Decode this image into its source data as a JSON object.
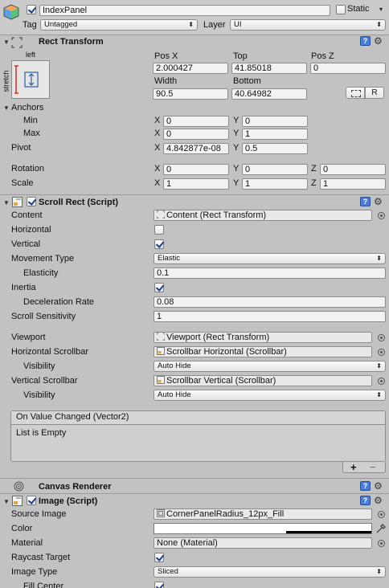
{
  "gameobject": {
    "name": "IndexPanel",
    "static_label": "Static",
    "tag_label": "Tag",
    "tag_value": "Untagged",
    "layer_label": "Layer",
    "layer_value": "UI"
  },
  "rect_transform": {
    "title": "Rect Transform",
    "anchor_preset_top": "left",
    "anchor_preset_side": "stretch",
    "pos_x_label": "Pos X",
    "top_label": "Top",
    "pos_z_label": "Pos Z",
    "pos_x": "2.000427",
    "top": "41.85018",
    "pos_z": "0",
    "width_label": "Width",
    "bottom_label": "Bottom",
    "width": "90.5",
    "bottom": "40.64982",
    "raw_button": "R",
    "anchors_label": "Anchors",
    "min_label": "Min",
    "max_label": "Max",
    "pivot_label": "Pivot",
    "rotation_label": "Rotation",
    "scale_label": "Scale",
    "x_label": "X",
    "y_label": "Y",
    "z_label": "Z",
    "anchor_min_x": "0",
    "anchor_min_y": "0",
    "anchor_max_x": "0",
    "anchor_max_y": "1",
    "pivot_x": "4.842877e-08",
    "pivot_y": "0.5",
    "rotation_x": "0",
    "rotation_y": "0",
    "rotation_z": "0",
    "scale_x": "1",
    "scale_y": "1",
    "scale_z": "1"
  },
  "scroll_rect": {
    "title": "Scroll Rect (Script)",
    "content_label": "Content",
    "content_value": "Content (Rect Transform)",
    "horizontal_label": "Horizontal",
    "horizontal_checked": false,
    "vertical_label": "Vertical",
    "vertical_checked": true,
    "movement_type_label": "Movement Type",
    "movement_type_value": "Elastic",
    "elasticity_label": "Elasticity",
    "elasticity_value": "0.1",
    "inertia_label": "Inertia",
    "inertia_checked": true,
    "deceleration_label": "Deceleration Rate",
    "deceleration_value": "0.08",
    "scroll_sensitivity_label": "Scroll Sensitivity",
    "scroll_sensitivity_value": "1",
    "viewport_label": "Viewport",
    "viewport_value": "Viewport (Rect Transform)",
    "h_scrollbar_label": "Horizontal Scrollbar",
    "h_scrollbar_value": "Scrollbar Horizontal (Scrollbar)",
    "h_visibility_label": "Visibility",
    "h_visibility_value": "Auto Hide",
    "v_scrollbar_label": "Vertical Scrollbar",
    "v_scrollbar_value": "Scrollbar Vertical (Scrollbar)",
    "v_visibility_label": "Visibility",
    "v_visibility_value": "Auto Hide",
    "event_title": "On Value Changed (Vector2)",
    "event_empty": "List is Empty",
    "add_button": "+",
    "remove_button": "−"
  },
  "canvas_renderer": {
    "title": "Canvas Renderer"
  },
  "image": {
    "title": "Image (Script)",
    "source_image_label": "Source Image",
    "source_image_value": "CornerPanelRadius_12px_Fill",
    "color_label": "Color",
    "color_value": "#ffffff",
    "material_label": "Material",
    "material_value": "None (Material)",
    "raycast_label": "Raycast Target",
    "raycast_checked": true,
    "image_type_label": "Image Type",
    "image_type_value": "Sliced",
    "fill_center_label": "Fill Center",
    "fill_center_checked": true
  }
}
